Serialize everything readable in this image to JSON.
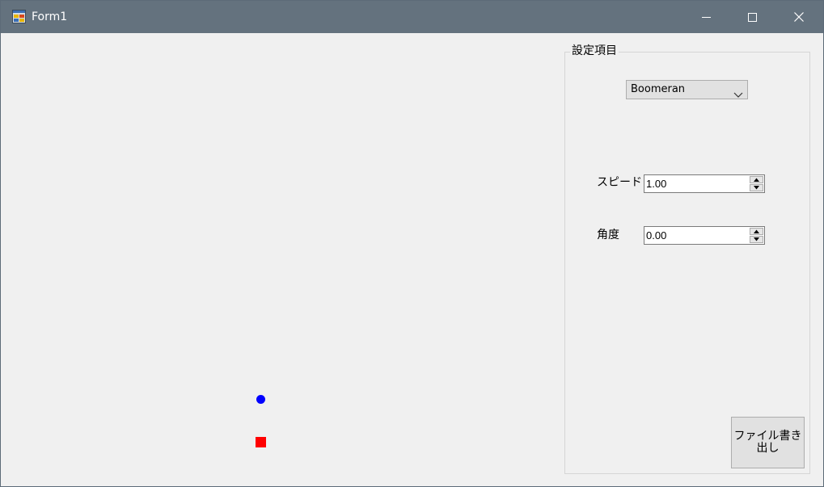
{
  "window": {
    "title": "Form1"
  },
  "titlebar_icons": {
    "app": "app-form-icon",
    "minimize": "minimize-icon",
    "maximize": "maximize-icon",
    "close": "close-icon"
  },
  "canvas": {
    "marker_colors": {
      "circle": "#0000ff",
      "square": "#ff0000"
    }
  },
  "settings": {
    "group_title": "設定項目",
    "pattern_select": {
      "selected": "Boomeran",
      "icon": "chevron-down-icon"
    },
    "speed": {
      "label": "スピード",
      "value": "1.00"
    },
    "angle": {
      "label": "角度",
      "value": "0.00"
    },
    "export_button": {
      "label": "ファイル書き\n出し"
    }
  },
  "colors": {
    "titlebar": "#64727e",
    "window_bg": "#f0f0f0",
    "button_bg": "#e1e1e1"
  }
}
